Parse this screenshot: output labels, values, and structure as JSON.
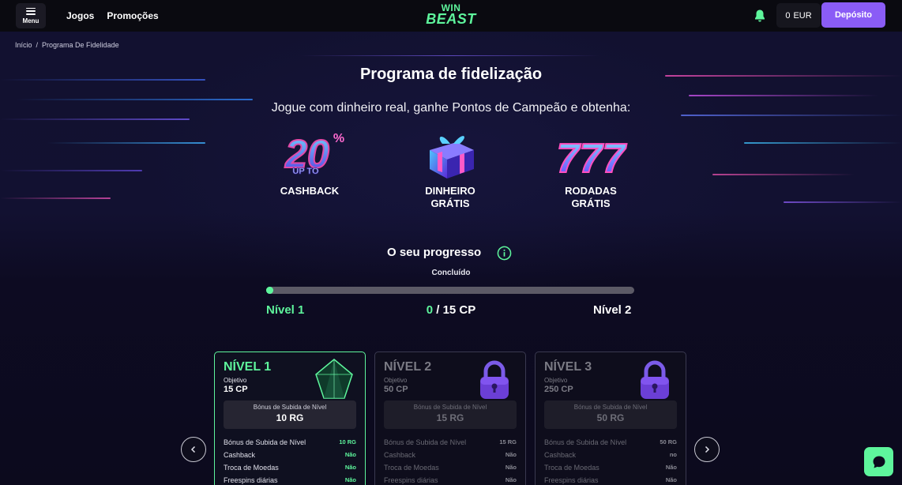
{
  "header": {
    "menu_label": "Menu",
    "nav": [
      "Jogos",
      "Promoções"
    ],
    "logo_top": "WIN",
    "logo_bottom": "BEAST",
    "balance_amount": "0",
    "balance_currency": "EUR",
    "deposit_label": "Depósito"
  },
  "breadcrumb": [
    "Início",
    "Programa De Fidelidade"
  ],
  "page": {
    "title": "Programa de fidelização",
    "subtitle": "Jogue com dinheiro real, ganhe Pontos de Campeão e obtenha:"
  },
  "benefits": [
    {
      "icon": "cashback-20-percent-icon",
      "badge_big": "20",
      "badge_pct": "%",
      "badge_small": "UP TO",
      "label": "CASHBACK"
    },
    {
      "icon": "gift-box-icon",
      "label_line1": "DINHEIRO",
      "label_line2": "GRÁTIS"
    },
    {
      "icon": "slot-777-icon",
      "badge_big": "777",
      "label_line1": "RODADAS",
      "label_line2": "GRÁTIS"
    }
  ],
  "progress": {
    "title": "O seu progresso",
    "status": "Concluído",
    "current_level": "Nível 1",
    "next_level": "Nível 2",
    "points_current": "0",
    "points_sep": " / ",
    "points_target": "15 CP",
    "fraction": 0.0
  },
  "levels": [
    {
      "name": "NÍVEL 1",
      "objective_label": "Objetivo",
      "objective_value": "15 CP",
      "bonus_label": "Bónus de Subida de Nível",
      "bonus_value": "10 RG",
      "rows": [
        {
          "k": "Bónus de Subida de Nível",
          "v": "10 RG"
        },
        {
          "k": "Cashback",
          "v": "Não"
        },
        {
          "k": "Troca de Moedas",
          "v": "Não"
        },
        {
          "k": "Freespins diárias",
          "v": "Não"
        }
      ],
      "badge_icon": "green-crystal-icon"
    },
    {
      "name": "NÍVEL 2",
      "objective_label": "Objetivo",
      "objective_value": "50 CP",
      "bonus_label": "Bónus de Subida de Nível",
      "bonus_value": "15 RG",
      "rows": [
        {
          "k": "Bónus de Subida de Nível",
          "v": "15 RG"
        },
        {
          "k": "Cashback",
          "v": "Não"
        },
        {
          "k": "Troca de Moedas",
          "v": "Não"
        },
        {
          "k": "Freespins diárias",
          "v": "Não"
        }
      ],
      "badge_icon": "padlock-icon"
    },
    {
      "name": "NÍVEL 3",
      "objective_label": "Objetivo",
      "objective_value": "250 CP",
      "bonus_label": "Bónus de Subida de Nível",
      "bonus_value": "50 RG",
      "rows": [
        {
          "k": "Bónus de Subida de Nível",
          "v": "50 RG"
        },
        {
          "k": "Cashback",
          "v": "no"
        },
        {
          "k": "Troca de Moedas",
          "v": "Não"
        },
        {
          "k": "Freespins diárias",
          "v": "Não"
        }
      ],
      "badge_icon": "padlock-icon"
    }
  ],
  "colors": {
    "accent": "#5ef59c",
    "deposit": "#8a5cf6",
    "background": "#0c0a1c"
  }
}
